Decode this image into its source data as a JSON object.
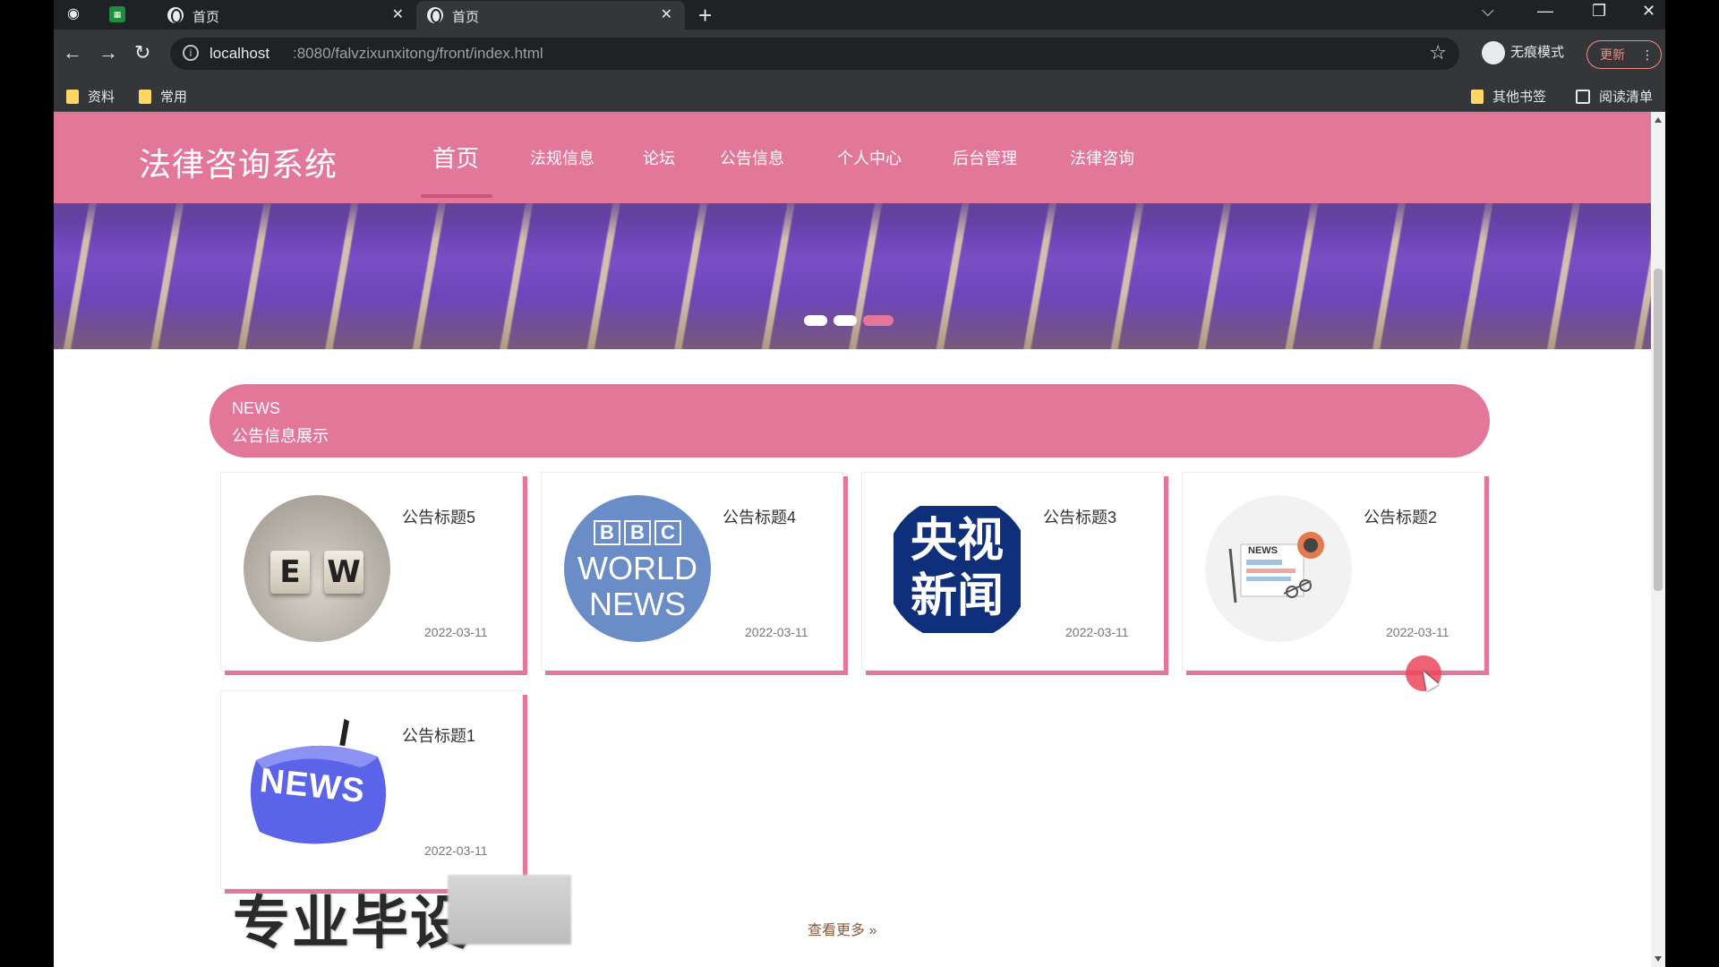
{
  "browser": {
    "tabs": [
      {
        "title": "首页",
        "active": false
      },
      {
        "title": "首页",
        "active": true
      }
    ],
    "url_host": "localhost",
    "url_path": ":8080/falvzixunxitong/front/index.html",
    "incognito_label": "无痕模式",
    "update_label": "更新",
    "bookmarks": [
      "资料",
      "常用"
    ],
    "other_bookmarks": "其他书签",
    "reading_list": "阅读清单"
  },
  "site": {
    "logo": "法律咨询系统",
    "nav": [
      "首页",
      "法规信息",
      "论坛",
      "公告信息",
      "个人中心",
      "后台管理",
      "法律咨询"
    ],
    "active_nav_index": 0
  },
  "news": {
    "title_en": "NEWS",
    "title_cn": "公告信息展示",
    "items": [
      {
        "title": "公告标题5",
        "date": "2022-03-11",
        "image": "ew-tiles"
      },
      {
        "title": "公告标题4",
        "date": "2022-03-11",
        "image": "bbc-world-news"
      },
      {
        "title": "公告标题3",
        "date": "2022-03-11",
        "image": "cctv-news"
      },
      {
        "title": "公告标题2",
        "date": "2022-03-11",
        "image": "newspaper-illustration"
      },
      {
        "title": "公告标题1",
        "date": "2022-03-11",
        "image": "news-ball"
      }
    ],
    "more_label": "查看更多 »"
  },
  "thumb_text": {
    "ew": [
      "E",
      "W"
    ],
    "bbc": [
      "B",
      "B",
      "C",
      "WORLD",
      "NEWS"
    ],
    "cctv": [
      "央视",
      "新闻"
    ],
    "paper": "NEWS",
    "ball": "NEWS"
  },
  "watermark": "专业毕设",
  "colors": {
    "accent": "#e3779a",
    "shadow": "#e3779a"
  }
}
